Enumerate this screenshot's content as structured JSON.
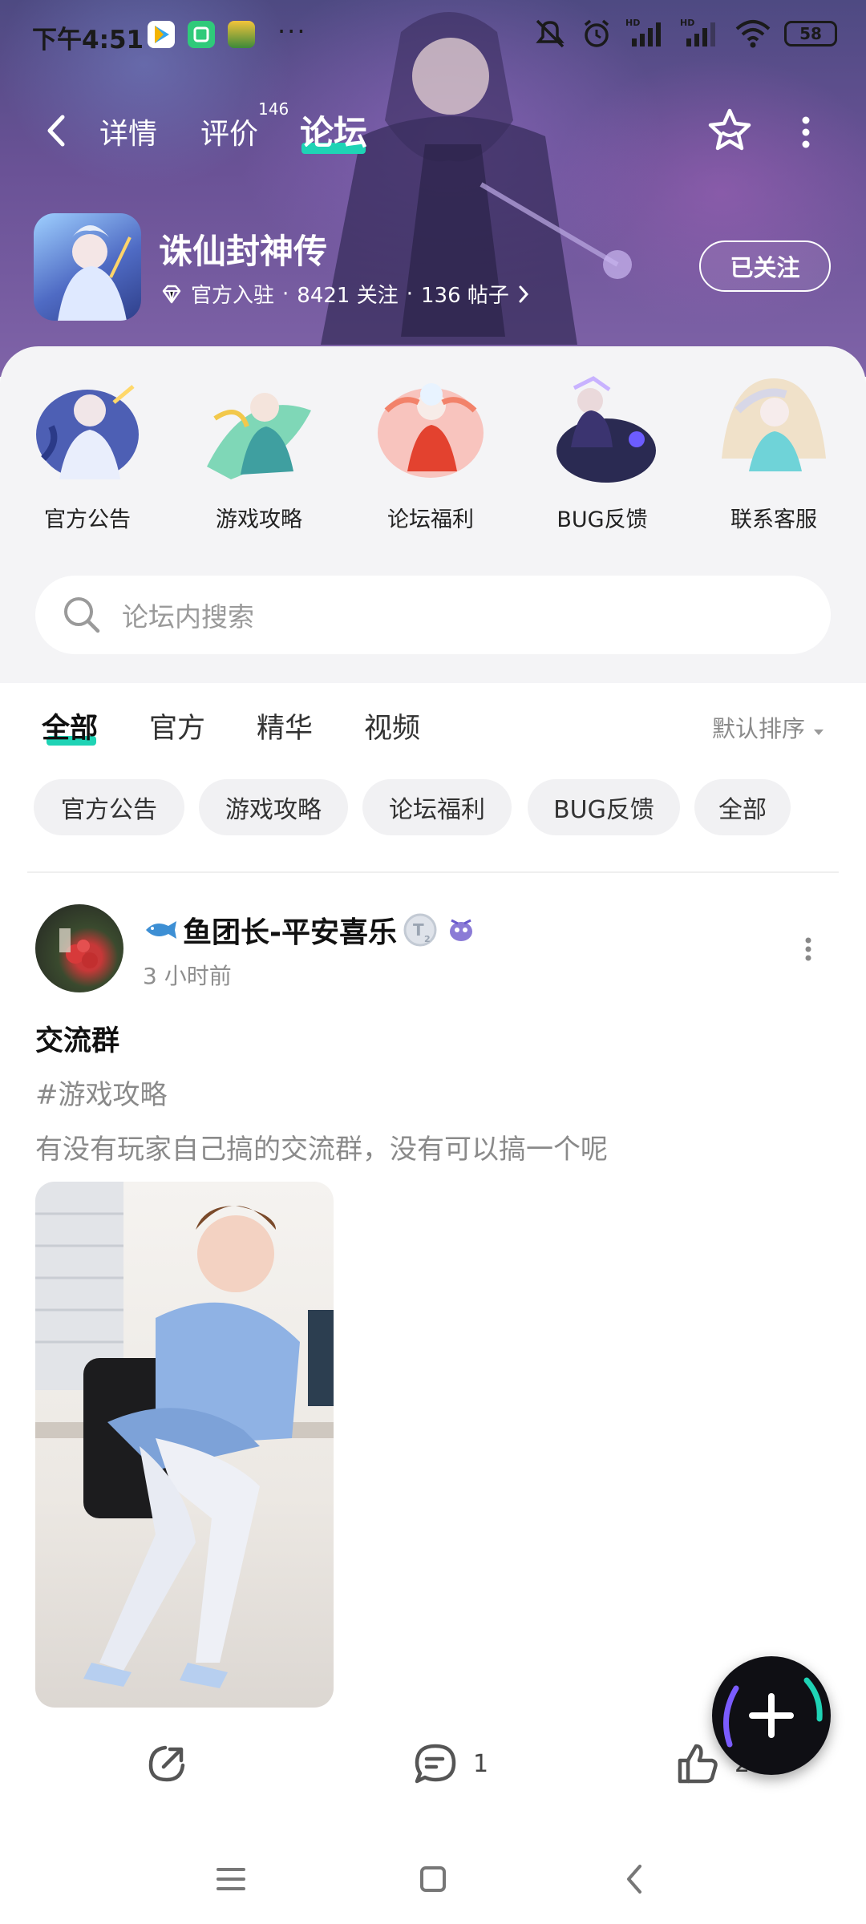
{
  "status_bar": {
    "time": "下午4:51",
    "more": "···",
    "battery": "58",
    "icons": [
      "play-store-icon",
      "shield-app-icon",
      "game-app-icon",
      "mute-icon",
      "alarm-icon",
      "signal-hd-icon",
      "signal-hd-icon",
      "wifi-icon",
      "battery-icon"
    ]
  },
  "nav": {
    "tabs": [
      {
        "label": "详情"
      },
      {
        "label": "评价",
        "badge": "146"
      },
      {
        "label": "论坛"
      }
    ],
    "active_tab": "论坛",
    "accent": "#1fd3b5"
  },
  "game": {
    "name": "诛仙封神传",
    "official": "官方入驻",
    "sep": "·",
    "followers": "8421 关注",
    "posts": "136 帖子",
    "follow_label": "已关注"
  },
  "categories": [
    {
      "label": "官方公告"
    },
    {
      "label": "游戏攻略"
    },
    {
      "label": "论坛福利"
    },
    {
      "label": "BUG反馈"
    },
    {
      "label": "联系客服"
    }
  ],
  "search": {
    "placeholder": "论坛内搜索"
  },
  "filter_tabs": [
    {
      "label": "全部"
    },
    {
      "label": "官方"
    },
    {
      "label": "精华"
    },
    {
      "label": "视频"
    }
  ],
  "sort_label": "默认排序",
  "chips": [
    {
      "label": "官方公告"
    },
    {
      "label": "游戏攻略"
    },
    {
      "label": "论坛福利"
    },
    {
      "label": "BUG反馈"
    },
    {
      "label": "全部"
    }
  ],
  "post": {
    "author": "鱼团长-平安喜乐",
    "time": "3 小时前",
    "title": "交流群",
    "tag": "#游戏攻略",
    "body": "有没有玩家自己搞的交流群，没有可以搞一个呢",
    "comments": "1",
    "likes": "2"
  }
}
